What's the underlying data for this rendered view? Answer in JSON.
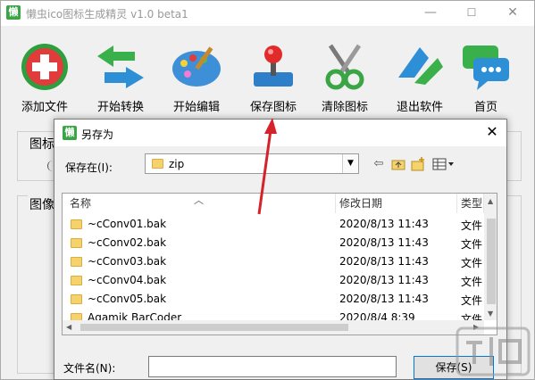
{
  "app": {
    "icon_glyph": "懒",
    "title": "懒虫ico图标生成精灵 v1.0 beta1",
    "controls": {
      "minimize": "—",
      "maximize": "☐",
      "close": "✕"
    }
  },
  "toolbar": {
    "buttons": [
      {
        "label": "添加文件",
        "icon": "add-file-icon"
      },
      {
        "label": "开始转换",
        "icon": "convert-icon"
      },
      {
        "label": "开始编辑",
        "icon": "edit-palette-icon"
      },
      {
        "label": "保存图标",
        "icon": "save-joystick-icon"
      },
      {
        "label": "清除图标",
        "icon": "clear-scissors-icon"
      },
      {
        "label": "退出软件",
        "icon": "exit-icon"
      },
      {
        "label": "首页",
        "icon": "home-chat-icon"
      }
    ]
  },
  "groups": {
    "group1_label": "图标",
    "group2_label": "图像"
  },
  "dialog": {
    "icon_glyph": "懒",
    "title": "另存为",
    "close": "✕",
    "save_in_label": "保存在(I):",
    "save_in_value": "zip",
    "columns": {
      "name": "名称",
      "date": "修改日期",
      "type": "类型"
    },
    "files": [
      {
        "name": "~cConv01.bak",
        "date": "2020/8/13 11:43",
        "type": "文件"
      },
      {
        "name": "~cConv02.bak",
        "date": "2020/8/13 11:43",
        "type": "文件"
      },
      {
        "name": "~cConv03.bak",
        "date": "2020/8/13 11:43",
        "type": "文件"
      },
      {
        "name": "~cConv04.bak",
        "date": "2020/8/13 11:43",
        "type": "文件"
      },
      {
        "name": "~cConv05.bak",
        "date": "2020/8/13 11:43",
        "type": "文件"
      },
      {
        "name": "Agamik BarCoder",
        "date": "2020/8/4 8:39",
        "type": "文件"
      }
    ],
    "filename_label": "文件名(N):",
    "filename_value": "",
    "save_button": "保存(S)"
  },
  "colors": {
    "arrow": "#d4232a",
    "save_border": "#0078d7",
    "folder": "#f5d26b"
  }
}
